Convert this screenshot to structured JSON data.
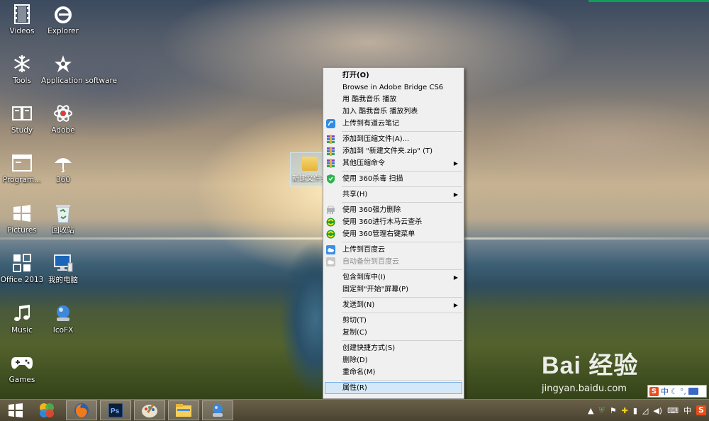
{
  "desktop": {
    "icons": [
      {
        "label": "Videos",
        "icon": "film-icon"
      },
      {
        "label": "Explorer",
        "icon": "ie-icon"
      },
      {
        "label": "Tools",
        "icon": "snowflake-icon"
      },
      {
        "label": "Application software",
        "icon": "app-star-icon"
      },
      {
        "label": "Study",
        "icon": "book-icon"
      },
      {
        "label": "Adobe",
        "icon": "adobe-icon"
      },
      {
        "label": "Program...",
        "icon": "window-icon"
      },
      {
        "label": "360",
        "icon": "umbrella-icon"
      },
      {
        "label": "Pictures",
        "icon": "windows-logo-icon"
      },
      {
        "label": "回收站",
        "icon": "recycle-bin-icon"
      },
      {
        "label": "Office 2013",
        "icon": "office-icon"
      },
      {
        "label": "我的电脑",
        "icon": "computer-icon"
      },
      {
        "label": "Music",
        "icon": "music-icon"
      },
      {
        "label": "IcoFX",
        "icon": "icofx-icon"
      },
      {
        "label": "Games",
        "icon": "gamepad-icon"
      }
    ],
    "selected_folder": {
      "label": "新建文件夹"
    }
  },
  "context_menu": {
    "items": [
      {
        "label": "打开(O)",
        "bold": true
      },
      {
        "label": "Browse in Adobe Bridge CS6"
      },
      {
        "label": "用 酷我音乐 播放"
      },
      {
        "label": "加入 酷我音乐 播放列表"
      },
      {
        "label": "上传到有道云笔记",
        "icon": "youdao-icon"
      },
      {
        "sep": true
      },
      {
        "label": "添加到压缩文件(A)...",
        "icon": "winrar-icon"
      },
      {
        "label": "添加到 \"新建文件夹.zip\" (T)",
        "icon": "winrar-icon"
      },
      {
        "label": "其他压缩命令",
        "icon": "winrar-icon",
        "submenu": true
      },
      {
        "sep": true
      },
      {
        "label": "使用 360杀毒 扫描",
        "icon": "shield-360-icon"
      },
      {
        "sep": true
      },
      {
        "label": "共享(H)",
        "submenu": true
      },
      {
        "sep": true
      },
      {
        "label": "使用 360强力删除",
        "icon": "shredder-icon"
      },
      {
        "label": "使用 360进行木马云查杀",
        "icon": "360-green-icon"
      },
      {
        "label": "使用 360管理右键菜单",
        "icon": "360-green-icon"
      },
      {
        "sep": true
      },
      {
        "label": "上传到百度云",
        "icon": "baidu-cloud-icon"
      },
      {
        "label": "自动备份到百度云",
        "icon": "baidu-cloud-gray-icon",
        "disabled": true
      },
      {
        "sep": true
      },
      {
        "label": "包含到库中(I)",
        "submenu": true
      },
      {
        "label": "固定到\"开始\"屏幕(P)"
      },
      {
        "sep": true
      },
      {
        "label": "发送到(N)",
        "submenu": true
      },
      {
        "sep": true
      },
      {
        "label": "剪切(T)"
      },
      {
        "label": "复制(C)"
      },
      {
        "sep": true
      },
      {
        "label": "创建快捷方式(S)"
      },
      {
        "label": "删除(D)"
      },
      {
        "label": "重命名(M)"
      },
      {
        "sep": true
      },
      {
        "label": "属性(R)",
        "highlighted": true
      }
    ]
  },
  "watermark": {
    "brand": "Bai 经验",
    "url": "jingyan.baidu.com"
  },
  "taskbar": {
    "buttons": [
      "windows-start-icon",
      "app-colorful-icon",
      "firefox-icon",
      "photoshop-icon",
      "paint-icon",
      "file-explorer-icon",
      "icofx-taskbar-icon"
    ],
    "ime": {
      "label": "中"
    },
    "tray_lang": "中",
    "tray_s": "S"
  },
  "colors": {
    "menu_bg": "#f0f0f0",
    "highlight": "#d5e8f7",
    "taskbar": "#5a5240"
  }
}
